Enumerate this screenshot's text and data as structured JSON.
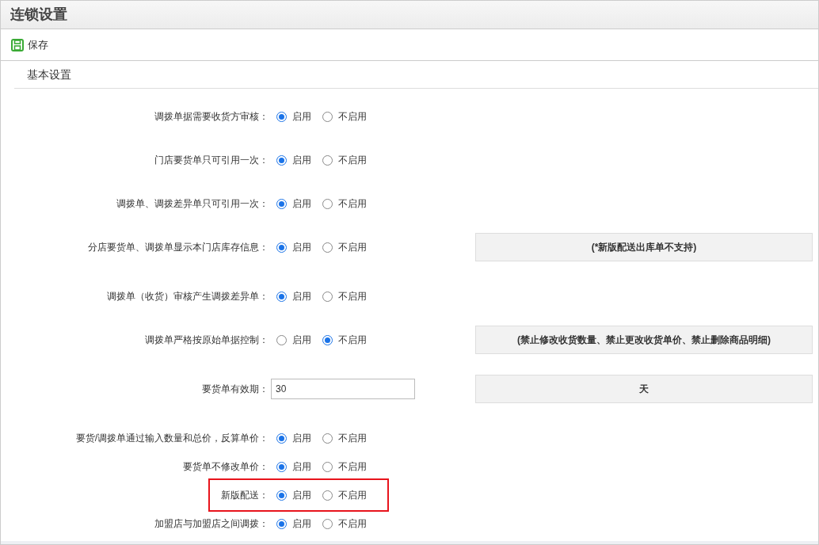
{
  "window": {
    "title": "连锁设置"
  },
  "toolbar": {
    "save_label": "保存"
  },
  "section": {
    "title": "基本设置"
  },
  "settings": [
    {
      "kind": "radio",
      "label": "调拨单据需要收货方审核：",
      "highlighted": false,
      "options": [
        {
          "label": "启用",
          "selected": true
        },
        {
          "label": "不启用",
          "selected": false
        }
      ]
    },
    {
      "kind": "radio",
      "label": "门店要货单只可引用一次：",
      "highlighted": false,
      "options": [
        {
          "label": "启用",
          "selected": true
        },
        {
          "label": "不启用",
          "selected": false
        }
      ]
    },
    {
      "kind": "radio",
      "label": "调拨单、调拨差异单只可引用一次：",
      "highlighted": false,
      "options": [
        {
          "label": "启用",
          "selected": true
        },
        {
          "label": "不启用",
          "selected": false
        }
      ]
    },
    {
      "kind": "radio",
      "label": "分店要货单、调拨单显示本门店库存信息：",
      "highlighted": false,
      "note": "(*新版配送出库单不支持)",
      "options": [
        {
          "label": "启用",
          "selected": true
        },
        {
          "label": "不启用",
          "selected": false
        }
      ]
    },
    {
      "kind": "radio",
      "label": "调拨单（收货）审核产生调拨差异单：",
      "highlighted": false,
      "options": [
        {
          "label": "启用",
          "selected": true
        },
        {
          "label": "不启用",
          "selected": false
        }
      ]
    },
    {
      "kind": "radio",
      "label": "调拨单严格按原始单据控制：",
      "highlighted": false,
      "note": "(禁止修改收货数量、禁止更改收货单价、禁止删除商品明细)",
      "options": [
        {
          "label": "启用",
          "selected": false
        },
        {
          "label": "不启用",
          "selected": true
        }
      ]
    },
    {
      "kind": "input",
      "label": "要货单有效期：",
      "highlighted": false,
      "value": "30",
      "note": "天"
    },
    {
      "kind": "radio",
      "label": "要货/调拨单通过输入数量和总价，反算单价：",
      "highlighted": false,
      "options": [
        {
          "label": "启用",
          "selected": true
        },
        {
          "label": "不启用",
          "selected": false
        }
      ]
    },
    {
      "kind": "radio",
      "label": "要货单不修改单价：",
      "highlighted": false,
      "options": [
        {
          "label": "启用",
          "selected": true
        },
        {
          "label": "不启用",
          "selected": false
        }
      ]
    },
    {
      "kind": "radio",
      "label": "新版配送：",
      "highlighted": true,
      "options": [
        {
          "label": "启用",
          "selected": true
        },
        {
          "label": "不启用",
          "selected": false
        }
      ]
    },
    {
      "kind": "radio",
      "label": "加盟店与加盟店之间调拨：",
      "highlighted": false,
      "options": [
        {
          "label": "启用",
          "selected": true
        },
        {
          "label": "不启用",
          "selected": false
        }
      ]
    }
  ]
}
